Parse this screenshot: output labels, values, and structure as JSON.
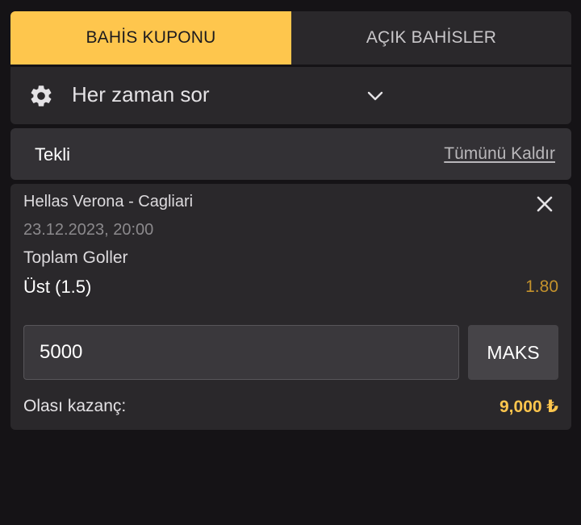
{
  "tabs": {
    "active_label": "BAHİS KUPONU",
    "inactive_label": "AÇIK BAHİSLER"
  },
  "settings": {
    "icon": "gear-icon",
    "label": "Her zaman sor",
    "dropdown_icon": "chevron-down-icon"
  },
  "bet_type": {
    "label": "Tekli",
    "remove_all": "Tümünü Kaldır"
  },
  "bet": {
    "match": "Hellas Verona - Cagliari",
    "datetime": "23.12.2023, 20:00",
    "market": "Toplam Goller",
    "selection": "Üst (1.5)",
    "odds": "1.80",
    "stake_value": "5000",
    "max_label": "MAKS",
    "potential_label": "Olası kazanç:",
    "potential_value": "9,000 ₺"
  },
  "colors": {
    "accent": "#fec64d",
    "odds": "#c4922c",
    "background": "#151316",
    "panel": "#2a282b"
  }
}
